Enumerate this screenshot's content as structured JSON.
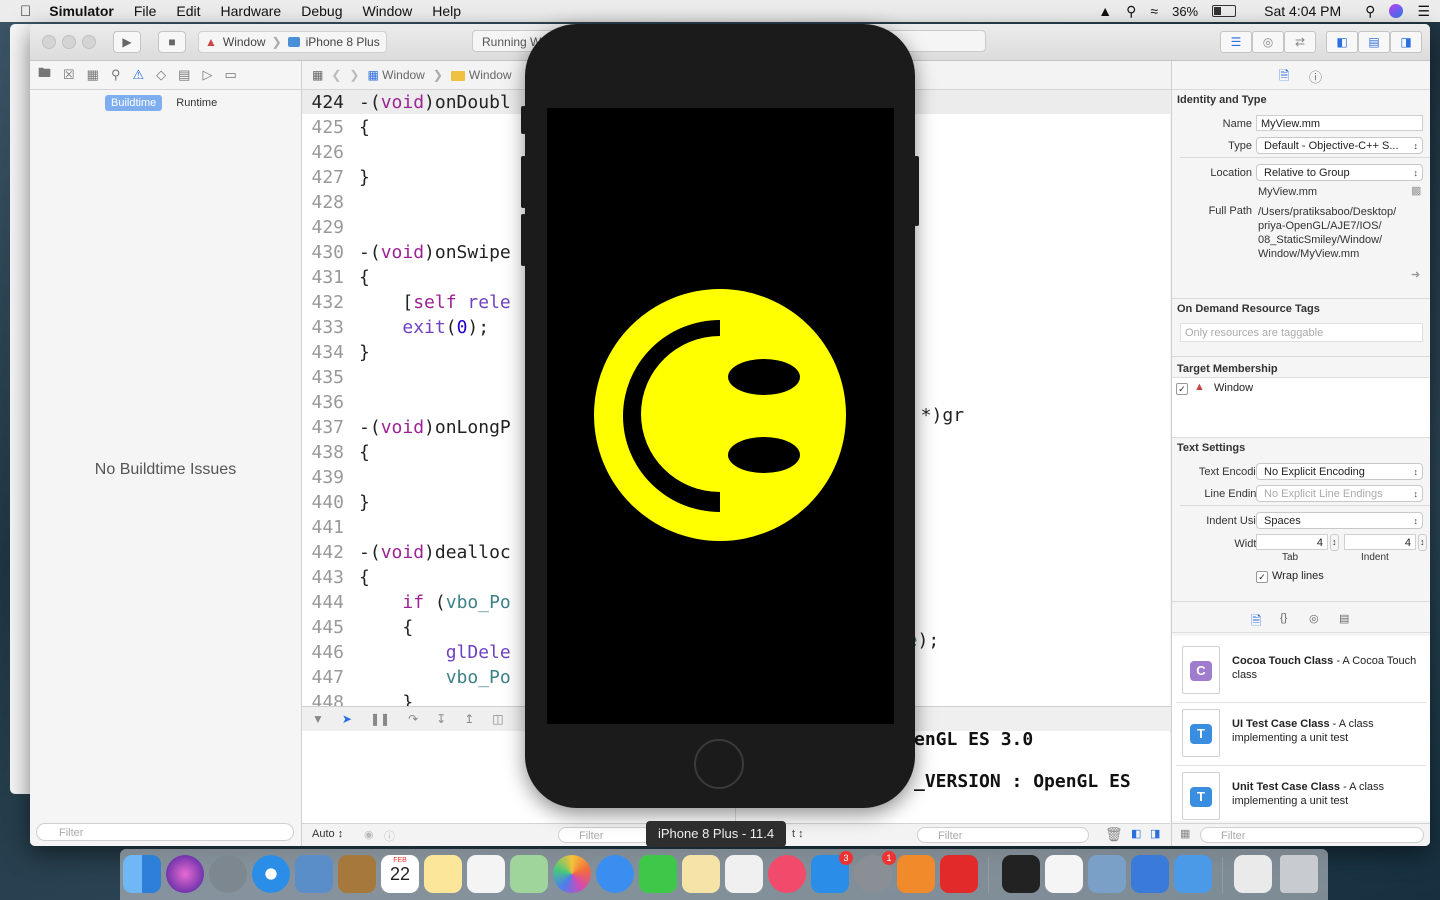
{
  "menubar": {
    "app": "Simulator",
    "items": [
      "File",
      "Edit",
      "Hardware",
      "Debug",
      "Window",
      "Help"
    ],
    "battery": "36%",
    "clock": "Sat 4:04 PM"
  },
  "toolbar": {
    "scheme": "Window",
    "device": "iPhone 8 Plus",
    "activity": "Running W"
  },
  "navigator": {
    "tabs": [
      "Buildtime",
      "Runtime"
    ],
    "empty_message": "No Buildtime Issues",
    "filter_placeholder": "Filter"
  },
  "jumpbar": {
    "crumbs": [
      "Window",
      "Window"
    ]
  },
  "editor": {
    "lines": [
      {
        "num": "424",
        "parts": [
          [
            "pr",
            "-("
          ],
          [
            "kw",
            "void"
          ],
          [
            "pr",
            ")onDoubl"
          ]
        ]
      },
      {
        "num": "425",
        "parts": [
          [
            "pr",
            "{"
          ]
        ]
      },
      {
        "num": "426",
        "parts": []
      },
      {
        "num": "427",
        "parts": [
          [
            "pr",
            "}"
          ]
        ]
      },
      {
        "num": "428",
        "parts": []
      },
      {
        "num": "429",
        "parts": []
      },
      {
        "num": "430",
        "parts": [
          [
            "pr",
            "-("
          ],
          [
            "kw",
            "void"
          ],
          [
            "pr",
            ")onSwipe"
          ]
        ]
      },
      {
        "num": "431",
        "parts": [
          [
            "pr",
            "{"
          ]
        ]
      },
      {
        "num": "432",
        "parts": [
          [
            "pr",
            "    ["
          ],
          [
            "kw",
            "self"
          ],
          [
            "pr",
            " "
          ],
          [
            "fn",
            "rele"
          ]
        ]
      },
      {
        "num": "433",
        "parts": [
          [
            "pr",
            "    "
          ],
          [
            "fn",
            "exit"
          ],
          [
            "pr",
            "("
          ],
          [
            "num0",
            "0"
          ],
          [
            "pr",
            ");"
          ]
        ]
      },
      {
        "num": "434",
        "parts": [
          [
            "pr",
            "}"
          ]
        ]
      },
      {
        "num": "435",
        "parts": []
      },
      {
        "num": "436",
        "parts": []
      },
      {
        "num": "437",
        "parts": [
          [
            "pr",
            "-("
          ],
          [
            "kw",
            "void"
          ],
          [
            "pr",
            ")onLongP"
          ]
        ]
      },
      {
        "num": "438",
        "parts": [
          [
            "pr",
            "{"
          ]
        ]
      },
      {
        "num": "439",
        "parts": []
      },
      {
        "num": "440",
        "parts": [
          [
            "pr",
            "}"
          ]
        ]
      },
      {
        "num": "441",
        "parts": []
      },
      {
        "num": "442",
        "parts": [
          [
            "pr",
            "-("
          ],
          [
            "kw",
            "void"
          ],
          [
            "pr",
            ")dealloc"
          ]
        ]
      },
      {
        "num": "443",
        "parts": [
          [
            "pr",
            "{"
          ]
        ]
      },
      {
        "num": "444",
        "parts": [
          [
            "pr",
            "    "
          ],
          [
            "kw",
            "if"
          ],
          [
            "pr",
            " ("
          ],
          [
            "tc",
            "vbo_Po"
          ]
        ]
      },
      {
        "num": "445",
        "parts": [
          [
            "pr",
            "    {"
          ]
        ]
      },
      {
        "num": "446",
        "parts": [
          [
            "pr",
            "        "
          ],
          [
            "fn",
            "glDele"
          ]
        ]
      },
      {
        "num": "447",
        "parts": [
          [
            "pr",
            "        "
          ],
          [
            "tc",
            "vbo_Po"
          ]
        ]
      },
      {
        "num": "448",
        "parts": [
          [
            "pr",
            "    }"
          ]
        ]
      }
    ],
    "right_437": [
      "r",
      " *)gr"
    ],
    "right_446": [
      "gle",
      ");"
    ]
  },
  "console": {
    "line1": "enGL ES 3.0",
    "line2": "_VERSION : OpenGL ES"
  },
  "bottombar": {
    "auto": "Auto",
    "filter": "Filter",
    "filter2": "Filter",
    "scope": "t"
  },
  "inspector": {
    "identity_title": "Identity and Type",
    "name_label": "Name",
    "name_value": "MyView.mm",
    "type_label": "Type",
    "type_value": "Default - Objective-C++ S...",
    "location_label": "Location",
    "location_value": "Relative to Group",
    "file_name": "MyView.mm",
    "fullpath_label": "Full Path",
    "fullpath_lines": [
      "/Users/pratiksaboo/Desktop/",
      "priya-OpenGL/AJE7/IOS/",
      "08_StaticSmiley/Window/",
      "Window/MyView.mm"
    ],
    "odr_title": "On Demand Resource Tags",
    "odr_placeholder": "Only resources are taggable",
    "target_title": "Target Membership",
    "target_name": "Window",
    "text_title": "Text Settings",
    "encoding_label": "Text Encoding",
    "encoding_value": "No Explicit Encoding",
    "endings_label": "Line Endings",
    "endings_value": "No Explicit Line Endings",
    "indent_label": "Indent Using",
    "indent_value": "Spaces",
    "widths_label": "Widths",
    "tab_value": "4",
    "indent_width_value": "4",
    "tab_caption": "Tab",
    "indent_caption": "Indent",
    "wrap_label": "Wrap lines",
    "filter": "Filter"
  },
  "templates": [
    {
      "name": "Cocoa Touch Class",
      "desc": " - A Cocoa Touch class",
      "letter": "C",
      "color": "#a07ccf"
    },
    {
      "name": "UI Test Case Class",
      "desc": " - A class implementing a unit test",
      "letter": "T",
      "color": "#3a8ee0"
    },
    {
      "name": "Unit Test Case Class",
      "desc": " - A class implementing a unit test",
      "letter": "T",
      "color": "#3a8ee0"
    }
  ],
  "simulator": {
    "tooltip": "iPhone 8 Plus - 11.4",
    "smiley_color": "#ffff00"
  },
  "dock": {
    "calendar_month": "FEB",
    "calendar_day": "22",
    "appstore_badge": "3",
    "prefs_badge": "1"
  }
}
